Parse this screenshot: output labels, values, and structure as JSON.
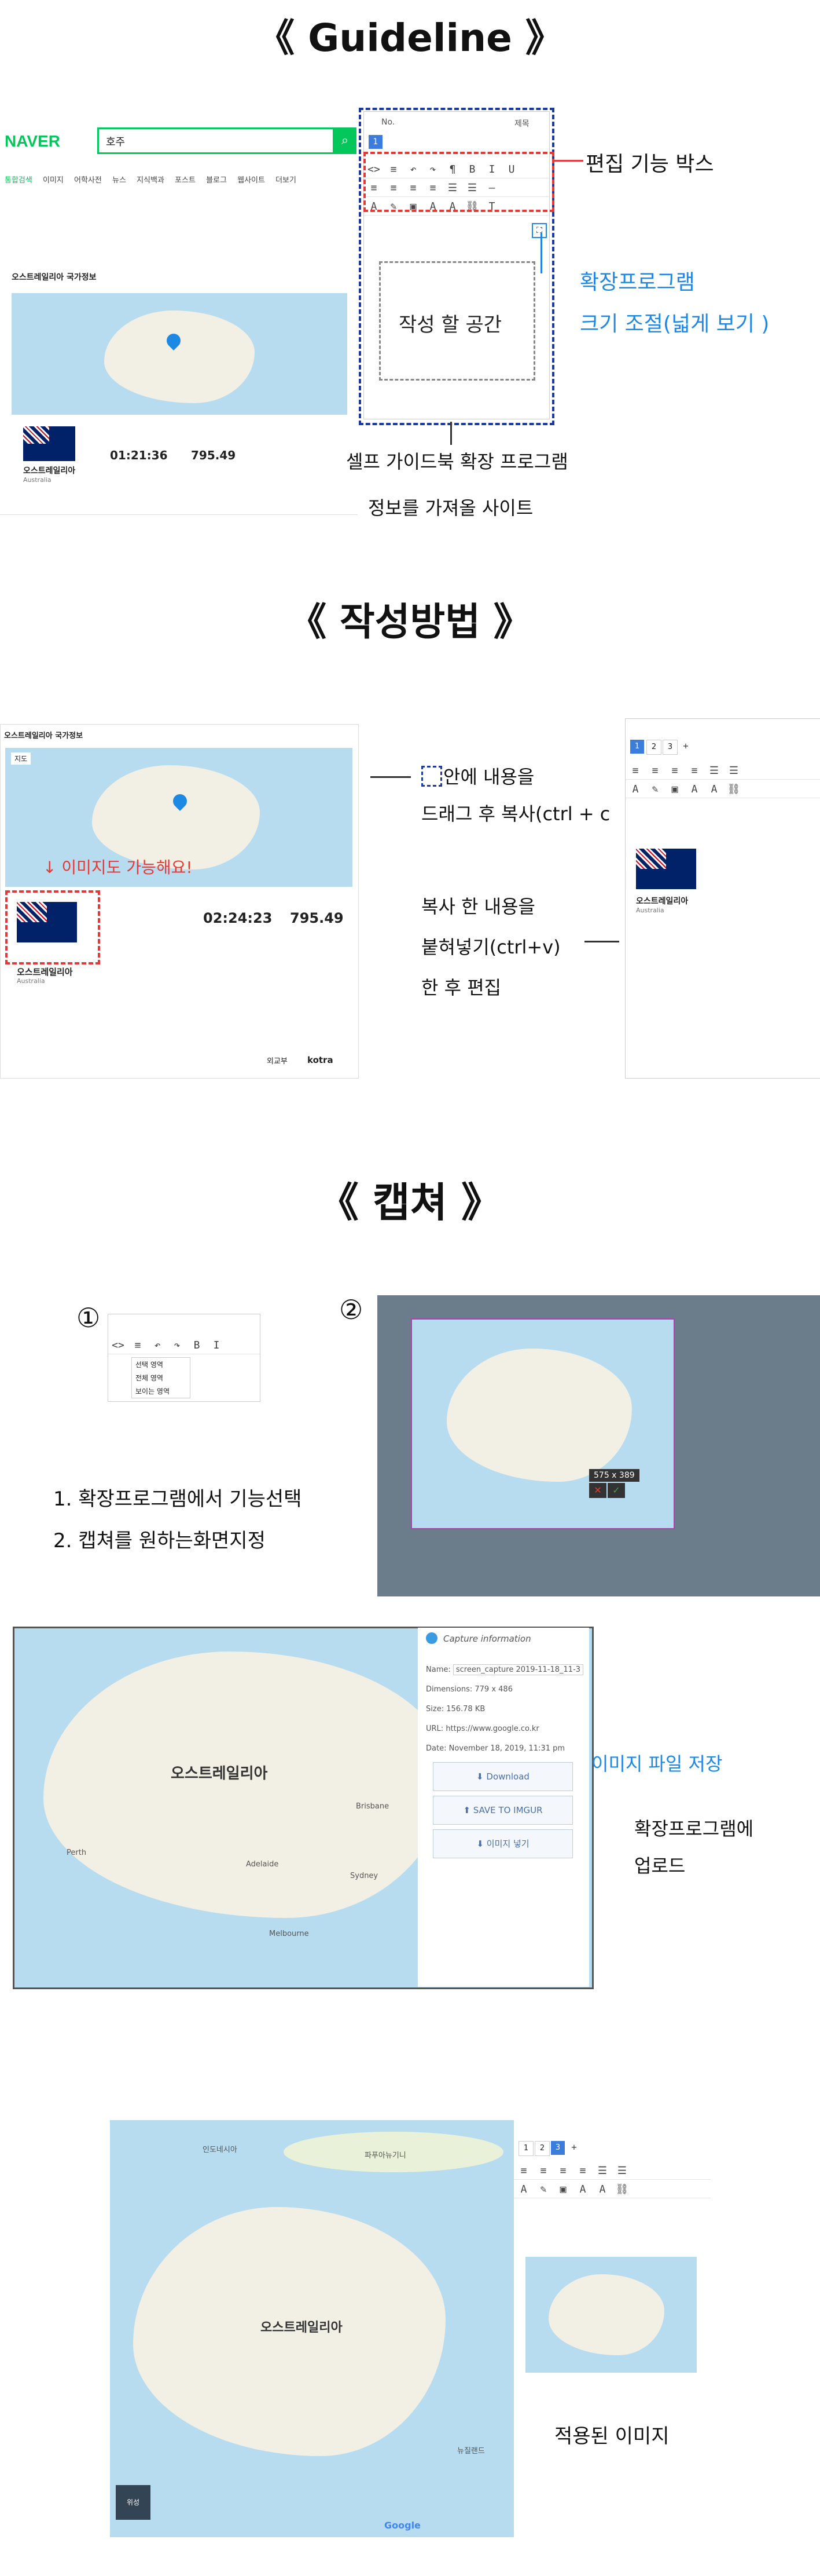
{
  "titles": {
    "guideline": "《 Guideline 》",
    "method": "《 작성방법 》",
    "capture": "《 캡쳐 》"
  },
  "guideline": {
    "naver_logo": "NAVER",
    "search_query": "호주",
    "nav_tabs": [
      "통합검색",
      "이미지",
      "어학사전",
      "뉴스",
      "지식백과",
      "포스트",
      "블로그",
      "웹사이트",
      "더보기"
    ],
    "info_header": "오스트레일리아 국가정보",
    "country_name": "오스트레일리아",
    "country_en": "Australia",
    "time": "01:21:36",
    "rate": "795.49",
    "edit_box_label": "편집 기능 박스",
    "expand_label_1": "확장프로그램",
    "expand_label_2": "크기 조절(넓게 보기 )",
    "write_area": "작성 할 공간",
    "self_guide_label": "셀프 가이드북 확장 프로그램",
    "source_label": "정보를 가져올 사이트",
    "editor_no": "No.",
    "editor_title": "제목",
    "editor_tab": "1"
  },
  "method": {
    "info_header": "오스트레일리아 국가정보",
    "map_tab": "지도",
    "country_name": "오스트레일리아",
    "country_en": "Australia",
    "image_ok": "↓ 이미지도 가능해요!",
    "time": "02:24:23",
    "rate": "795.49",
    "drag_text_1": "안에 내용을",
    "drag_text_2": "드래그 후 복사(ctrl + c",
    "paste_text_1": "복사 한 내용을",
    "paste_text_2": "붙혀넣기(ctrl+v)",
    "paste_text_3": "한 후 편집",
    "editor_tabs": [
      "1",
      "2",
      "3",
      "+"
    ],
    "pasted_title": "오스트레일리아",
    "pasted_sub": "Australia",
    "footer_logos": [
      "외교부",
      "kotra"
    ]
  },
  "capture": {
    "step1_mark": "①",
    "step2_mark": "②",
    "instruction_1": "1. 확장프로그램에서 기능선택",
    "instruction_2": "2. 캡쳐를 원하는화면지정",
    "menu_items": [
      "선택 영역",
      "전체 영역",
      "보이는 영역"
    ],
    "size_badge": "575 x 389",
    "capture_info_title": "Capture information",
    "info_rows": [
      {
        "label": "Name",
        "value": "screen_capture 2019-11-18_11-3"
      },
      {
        "label": "Dimensions",
        "value": "779 x 486"
      },
      {
        "label": "Size",
        "value": "156.78 KB"
      },
      {
        "label": "URL",
        "value": "https://www.google.co.kr"
      },
      {
        "label": "Date",
        "value": "November 18, 2019, 11:31 pm"
      }
    ],
    "download_button": "Download",
    "imgur_button": "SAVE TO IMGUR",
    "insert_button": "이미지 넣기",
    "save_label": "이미지 파일 저장",
    "upload_label_1": "확장프로그램에",
    "upload_label_2": "업로드",
    "map_label": "오스트레일리아",
    "applied_label": "적용된 이미지",
    "google_label": "Google",
    "cities": [
      "Perth",
      "Adelaide",
      "Melbourne",
      "Sydney",
      "Brisbane",
      "뉴질랜드",
      "인도네시아",
      "파푸아뉴기니"
    ],
    "editor_tabs": [
      "1",
      "2",
      "3",
      "+"
    ],
    "sat_label": "위성"
  }
}
